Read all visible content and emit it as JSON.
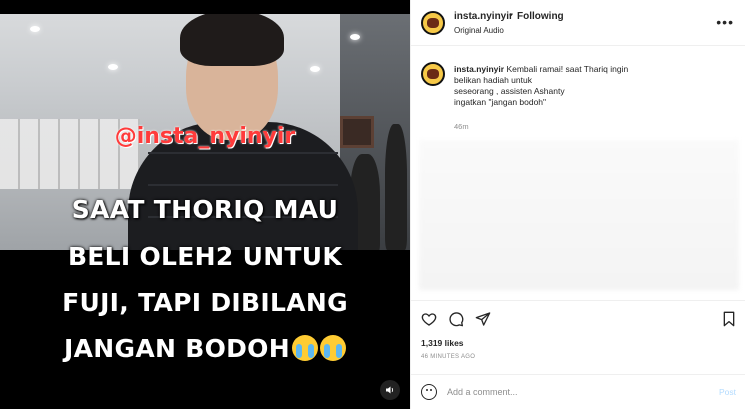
{
  "media": {
    "overlay_handle": "@insta_nyinyir",
    "caption_lines": [
      "SAAT THORIQ MAU",
      "BELI OLEH2 UNTUK",
      "FUJI, TAPI DIBILANG",
      "JANGAN BODOH"
    ],
    "sound_icon": "speaker-icon"
  },
  "header": {
    "username": "insta.nyinyir",
    "separator": "•",
    "follow_status": "Following",
    "audio": "Original Audio"
  },
  "post": {
    "username": "insta.nyinyir",
    "caption_lines": [
      "Kembali ramai! saat Thariq ingin",
      "belikan hadiah untuk",
      "seseorang , assisten Ashanty",
      "ingatkan \"jangan bodoh\""
    ],
    "time": "46m"
  },
  "actions": {
    "icons": [
      "heart-icon",
      "comment-icon",
      "share-icon",
      "bookmark-icon"
    ],
    "likes": "1,319 likes",
    "ago": "46 MINUTES AGO"
  },
  "comment": {
    "placeholder": "Add a comment...",
    "post_label": "Post"
  },
  "colors": {
    "link": "#b3dbff",
    "handle_overlay": "#ff3b3b",
    "meta": "#8e8e8e"
  }
}
